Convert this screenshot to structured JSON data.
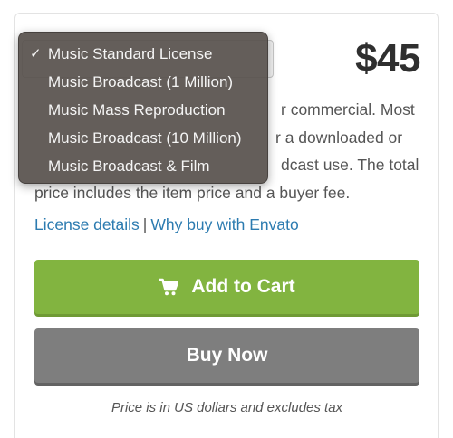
{
  "license": {
    "options": [
      {
        "label": "Music Standard License",
        "selected": true
      },
      {
        "label": "Music Broadcast (1 Million)",
        "selected": false
      },
      {
        "label": "Music Mass Reproduction",
        "selected": false
      },
      {
        "label": "Music Broadcast (10 Million)",
        "selected": false
      },
      {
        "label": "Music Broadcast & Film",
        "selected": false
      }
    ],
    "check_glyph": "✓"
  },
  "price": "$45",
  "description": {
    "line1": "r commercial. Most",
    "line2": "r a downloaded or",
    "line3": "dcast use. The total",
    "line4": "price includes the item price and a buyer fee."
  },
  "links": {
    "license_details": "License details",
    "separator": "|",
    "why_buy": "Why buy with Envato"
  },
  "buttons": {
    "add_to_cart": "Add to Cart",
    "buy_now": "Buy Now"
  },
  "note": "Price is in US dollars and excludes tax",
  "colors": {
    "cart_green": "#82b440",
    "buy_gray": "#7e7e7e",
    "link_blue": "#2c7bb0",
    "dropdown_bg": "#58524e"
  },
  "icons": {
    "cart": "shopping-cart-icon"
  }
}
